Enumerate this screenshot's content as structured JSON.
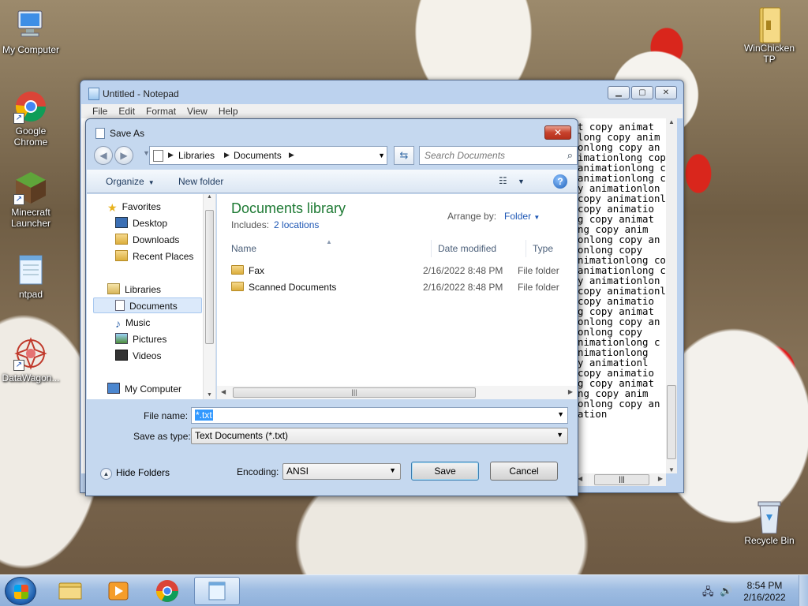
{
  "desktop": {
    "icons": [
      {
        "label": "My Computer",
        "icon": "computer-icon"
      },
      {
        "label": "Google Chrome",
        "icon": "chrome-icon"
      },
      {
        "label": "Minecraft Launcher",
        "icon": "minecraft-icon"
      },
      {
        "label": "ntpad",
        "icon": "notepad-icon"
      },
      {
        "label": "DataWagon...",
        "icon": "datawagon-icon"
      },
      {
        "label": "WinChicken TP",
        "icon": "folder-icon"
      },
      {
        "label": "Recycle Bin",
        "icon": "recycle-bin-icon"
      }
    ]
  },
  "notepad": {
    "title": "Untitled - Notepad",
    "menu": [
      "File",
      "Edit",
      "Format",
      "View",
      "Help"
    ],
    "text_lines": [
      "t copy animat",
      "long copy anim",
      "onlong copy an",
      "imationlong copy",
      "animationlong cop",
      "animationlong c",
      "y animationlon",
      "copy animationl",
      "copy animatio",
      "g copy animat",
      "ng copy anim",
      "onlong copy an",
      "onlong copy",
      "nimationlong cop",
      "animationlong c",
      "y animationlon",
      "copy animationl",
      "copy animatio",
      "g copy animat",
      "onlong copy an",
      "onlong copy",
      "nimationlong c",
      "nimationlong",
      "y animationl",
      "copy animatio",
      "g copy animat",
      "ng copy anim",
      "onlong copy an",
      "ation"
    ]
  },
  "dialog": {
    "title": "Save As",
    "address": {
      "crumbs": [
        "Libraries",
        "Documents"
      ]
    },
    "search_placeholder": "Search Documents",
    "toolbar": {
      "organize": "Organize",
      "new_folder": "New folder"
    },
    "nav": {
      "favorites": "Favorites",
      "desktop": "Desktop",
      "downloads": "Downloads",
      "recent": "Recent Places",
      "libraries": "Libraries",
      "documents": "Documents",
      "music": "Music",
      "pictures": "Pictures",
      "videos": "Videos",
      "my_computer": "My Computer"
    },
    "library": {
      "title": "Documents library",
      "includes_label": "Includes:",
      "includes_link": "2 locations",
      "arrange_label": "Arrange by:",
      "arrange_value": "Folder"
    },
    "columns": {
      "name": "Name",
      "date": "Date modified",
      "type": "Type"
    },
    "rows": [
      {
        "name": "Fax",
        "date": "2/16/2022 8:48 PM",
        "type": "File folder"
      },
      {
        "name": "Scanned Documents",
        "date": "2/16/2022 8:48 PM",
        "type": "File folder"
      }
    ],
    "file_name_label": "File name:",
    "file_name_value": "*.txt",
    "save_type_label": "Save as type:",
    "save_type_value": "Text Documents (*.txt)",
    "hide_folders": "Hide Folders",
    "encoding_label": "Encoding:",
    "encoding_value": "ANSI",
    "save_button": "Save",
    "cancel_button": "Cancel"
  },
  "taskbar": {
    "time": "8:54 PM",
    "date": "2/16/2022"
  }
}
